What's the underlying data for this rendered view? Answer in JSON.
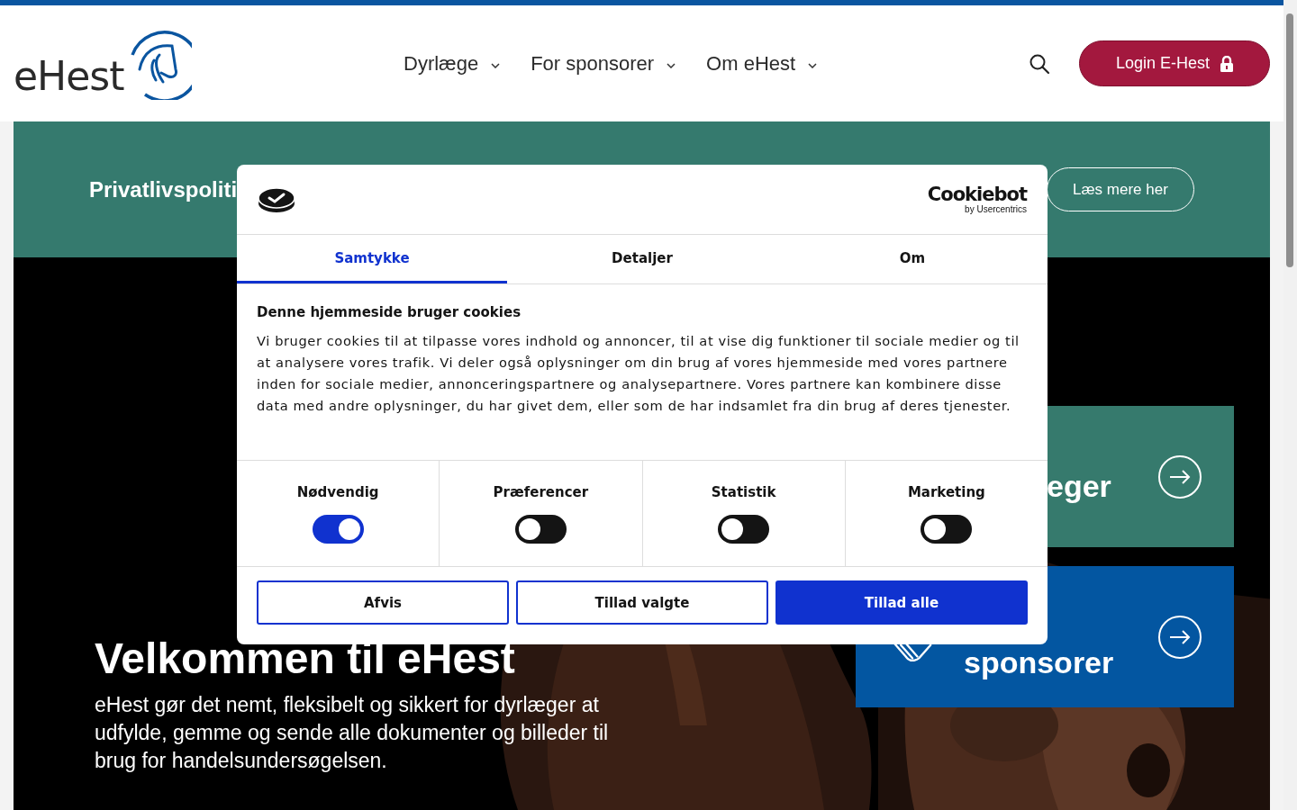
{
  "header": {
    "logo_text": "eHest",
    "nav": [
      {
        "label": "Dyrlæge"
      },
      {
        "label": "For sponsorer"
      },
      {
        "label": "Om eHest"
      }
    ],
    "login_button": "Login E-Hest"
  },
  "banner": {
    "title": "Privatlivspoliti",
    "button": "Læs mere her"
  },
  "cards": [
    {
      "title": "eger",
      "color": "#367a6d",
      "kind": "plain"
    },
    {
      "title": "sponsorer",
      "color": "#0356a1",
      "kind": "handshake"
    }
  ],
  "hero": {
    "title": "Velkommen til eHest",
    "text": "eHest gør det nemt, fleksibelt og sikkert for dyrlæger at udfylde, gemme og sende alle dokumenter og billeder til brug for handelsundersøgelsen."
  },
  "cookie_dialog": {
    "brand": {
      "name": "Cookiebot",
      "byline": "by Usercentrics"
    },
    "tabs": [
      {
        "label": "Samtykke",
        "selected": true
      },
      {
        "label": "Detaljer",
        "selected": false
      },
      {
        "label": "Om",
        "selected": false
      }
    ],
    "heading": "Denne hjemmeside bruger cookies",
    "body": "Vi bruger cookies til at tilpasse vores indhold og annoncer, til at vise dig funktioner til sociale medier og til at analysere vores trafik. Vi deler også oplysninger om din brug af vores hjemmeside med vores partnere inden for sociale medier, annonceringspartnere og analysepartnere. Vores partnere kan kombinere disse data med andre oplysninger, du har givet dem, eller som de har indsamlet fra din brug af deres tjenester.",
    "categories": [
      {
        "label": "Nødvendig",
        "on": true
      },
      {
        "label": "Præferencer",
        "on": false
      },
      {
        "label": "Statistik",
        "on": false
      },
      {
        "label": "Marketing",
        "on": false
      }
    ],
    "buttons": [
      {
        "label": "Afvis",
        "kind": "outline"
      },
      {
        "label": "Tillad valgte",
        "kind": "outline"
      },
      {
        "label": "Tillad alle",
        "kind": "primary"
      }
    ]
  }
}
